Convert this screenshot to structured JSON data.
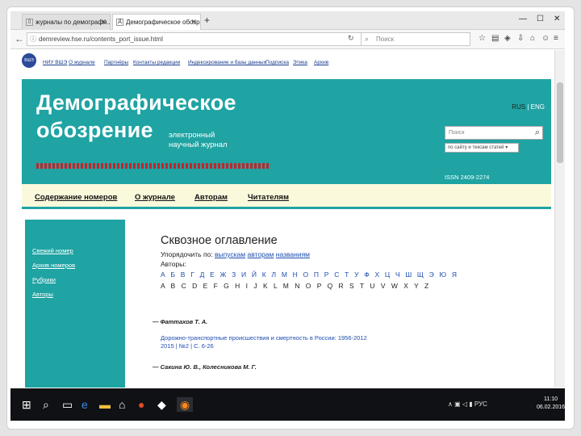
{
  "tabs": [
    {
      "label": "журналы по демографи...",
      "icon": "document-icon"
    },
    {
      "label": "Демографическое обозр...",
      "icon": "site-favicon-icon"
    }
  ],
  "url": "demreview.hse.ru/contents_port_issue.html",
  "search_placeholder": "Поиск",
  "hse_links": [
    "НИУ ВШЭ",
    "О журнале",
    "Партнёры",
    "Контакты редакции",
    "Индексирование и базы данных",
    "Подписка",
    "Этика",
    "Архив"
  ],
  "banner": {
    "title_line1": "Демографическое",
    "title_line2": "обозрение",
    "subtitle": "электронный научный журнал",
    "lang_rus": "RUS",
    "lang_sep": " | ",
    "lang_eng": "ENG",
    "search_placeholder": "Поиск",
    "search_scope": "по сайту и тексам статей",
    "issn": "ISSN 2409-2274"
  },
  "main_nav": [
    "Содержание номеров",
    "О журнале",
    "Авторам",
    "Читателям"
  ],
  "sidebar": [
    "Свежий номер",
    "Архив номеров",
    "Рубрики",
    "Авторы"
  ],
  "content": {
    "heading": "Сквозное оглавление",
    "sort_prefix": "Упорядочить по:",
    "sort_by_issue": "выпускам",
    "sort_by_author": "авторам",
    "sort_by_title": "названиям",
    "authors_label": "Авторы:",
    "cyrillic_letters": "А Б В Г Д Е Ж З И Й К Л М Н О П Р С Т У Ф Х Ц Ч Ш Щ Э Ю Я",
    "latin_letters": "A B C D E F G H I J K L M N O P Q R S T U V W X Y Z",
    "entries": [
      {
        "author": "— Фаттахов Т. А.",
        "title": "Дорожно-транспортные происшествия и смертность в России: 1956-2012",
        "ref": "2015 | №2 | С. 6-26"
      },
      {
        "author": "— Сакина Ю. В., Колесникова М. Г.",
        "title": "",
        "ref": ""
      }
    ]
  },
  "taskbar": {
    "time": "11:10",
    "date": "06.02.2016",
    "lang": "РУС"
  }
}
